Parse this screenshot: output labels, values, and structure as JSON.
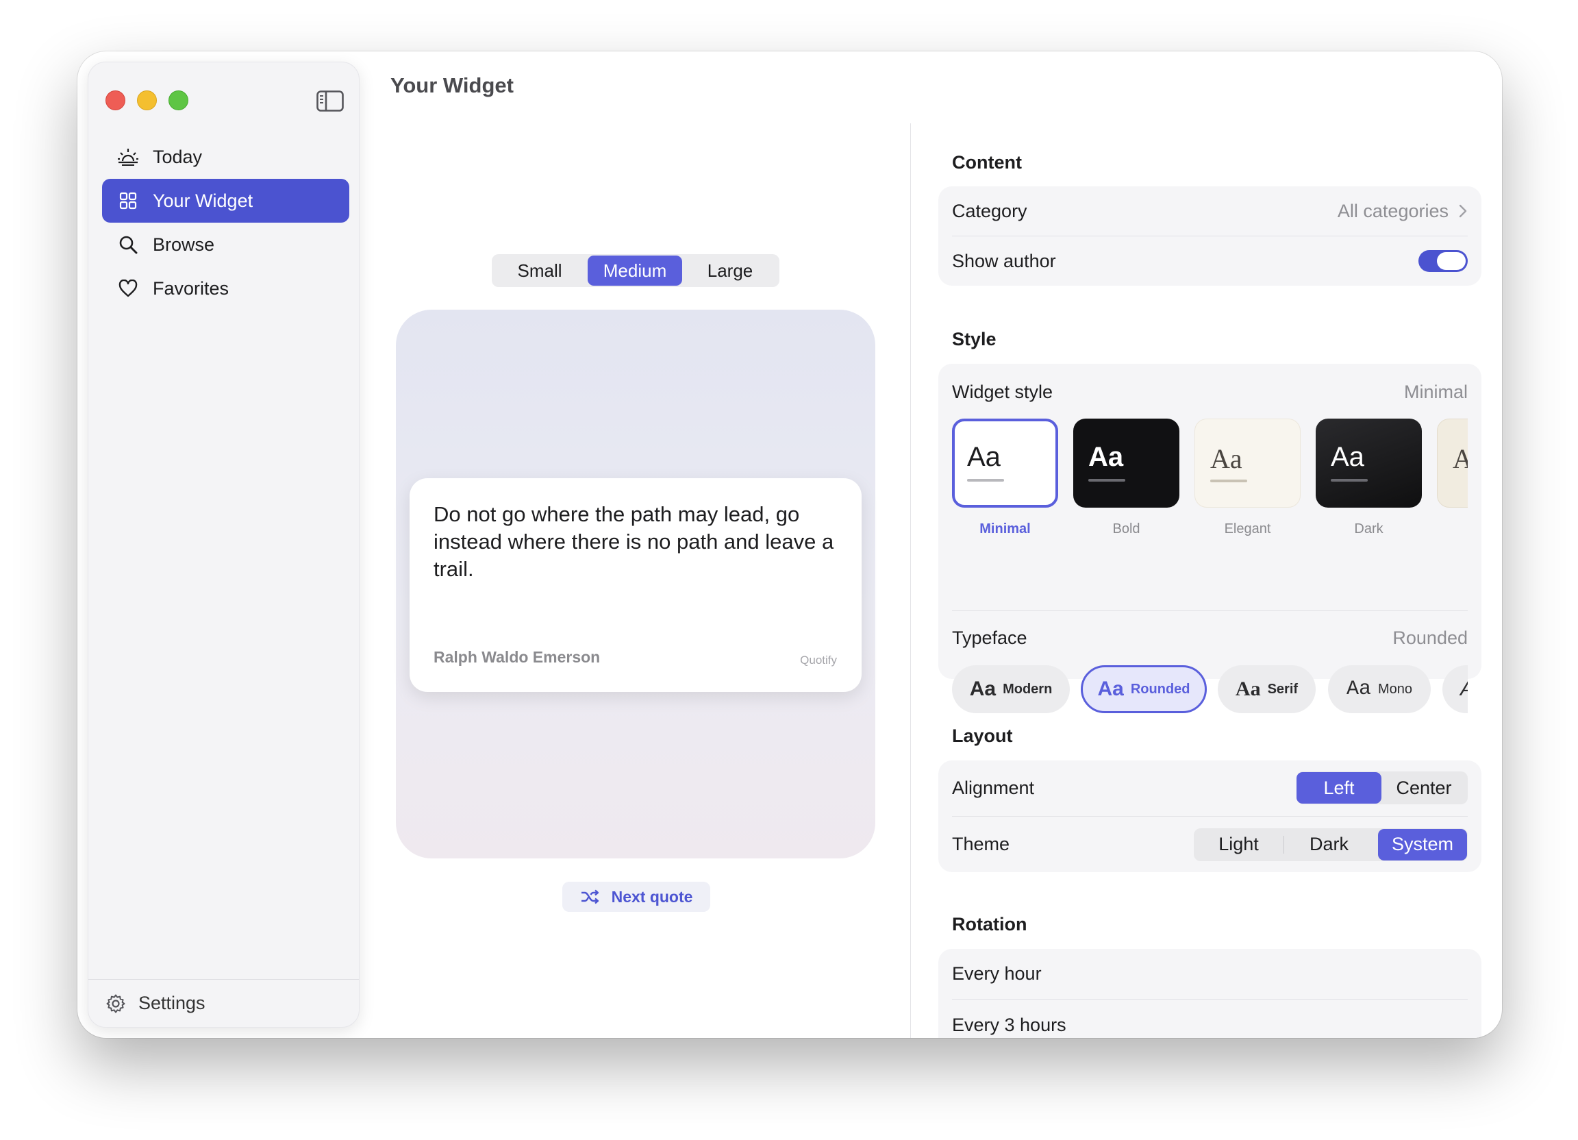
{
  "window": {
    "title": "Your Widget"
  },
  "sidebar": {
    "items": [
      {
        "label": "Today",
        "icon": "sunrise-icon"
      },
      {
        "label": "Your Widget",
        "icon": "grid-icon",
        "active": true
      },
      {
        "label": "Browse",
        "icon": "search-icon"
      },
      {
        "label": "Favorites",
        "icon": "heart-icon"
      }
    ],
    "footer": {
      "label": "Settings",
      "icon": "gear-icon"
    }
  },
  "preview": {
    "sizes": [
      "Small",
      "Medium",
      "Large"
    ],
    "selected_size": "Medium",
    "quote": {
      "text": "Do not go where the path may lead, go instead where there is no path and leave a trail.",
      "author": "Ralph Waldo Emerson",
      "brand": "Quotify"
    },
    "next_button": "Next quote"
  },
  "content": {
    "title": "Content",
    "category_label": "Category",
    "category_value": "All categories",
    "show_author_label": "Show author",
    "show_author": true
  },
  "style": {
    "title": "Style",
    "widget_style_label": "Widget style",
    "widget_style_value": "Minimal",
    "styles": [
      {
        "sample": "Aa",
        "name": "Minimal",
        "selected": true
      },
      {
        "sample": "Aa",
        "name": "Bold"
      },
      {
        "sample": "Aa",
        "name": "Elegant"
      },
      {
        "sample": "Aa",
        "name": "Dark"
      },
      {
        "sample": "A",
        "name": ""
      }
    ],
    "typeface_label": "Typeface",
    "typeface_value": "Rounded",
    "typefaces": [
      {
        "sample": "Aa",
        "name": "Modern"
      },
      {
        "sample": "Aa",
        "name": "Rounded",
        "selected": true
      },
      {
        "sample": "Aa",
        "name": "Serif"
      },
      {
        "sample": "Aa",
        "name": "Mono"
      },
      {
        "sample": "A",
        "name": ""
      }
    ]
  },
  "layout": {
    "title": "Layout",
    "alignment_label": "Alignment",
    "alignment_options": [
      "Left",
      "Center"
    ],
    "alignment_selected": "Left",
    "theme_label": "Theme",
    "theme_options": [
      "Light",
      "Dark",
      "System"
    ],
    "theme_selected": "System"
  },
  "rotation": {
    "title": "Rotation",
    "options": [
      "Every hour",
      "Every 3 hours"
    ]
  },
  "colors": {
    "accent": "#4b53d0",
    "accent_light": "#5a5fdc"
  }
}
